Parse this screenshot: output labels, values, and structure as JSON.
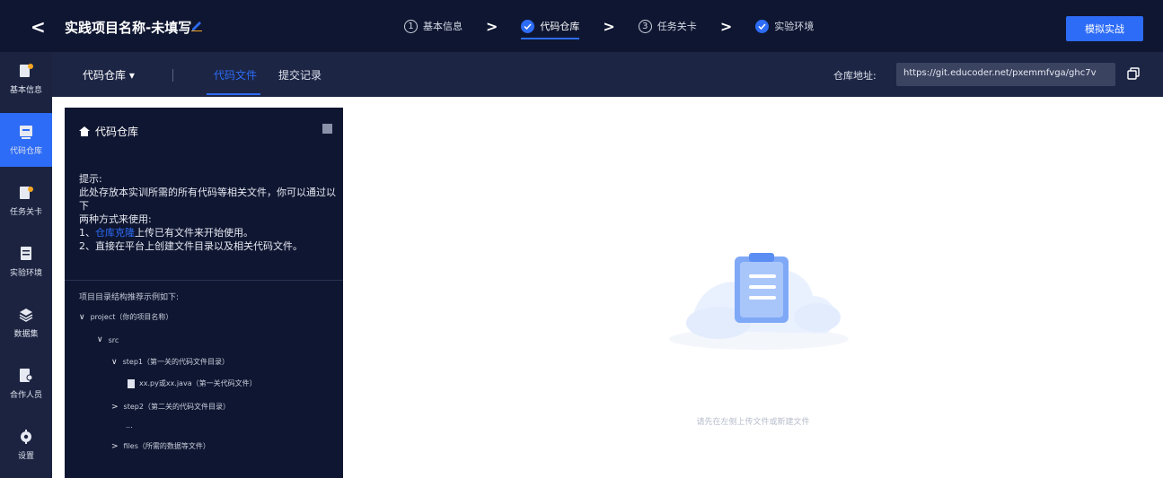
{
  "header": {
    "back_glyph": "<",
    "project_title": "实践项目名称-未填写",
    "steps": [
      {
        "num": "1",
        "label": "基本信息",
        "state": "todo"
      },
      {
        "num": "2",
        "label": "代码仓库",
        "state": "done"
      },
      {
        "num": "3",
        "label": "任务关卡",
        "state": "todo"
      },
      {
        "num": "4",
        "label": "实验环境",
        "state": "done"
      }
    ],
    "step_separator": ">",
    "publish_label": "模拟实战"
  },
  "sidebar": {
    "items": [
      {
        "label": "基本信息",
        "icon": "basic-info-icon"
      },
      {
        "label": "代码仓库",
        "icon": "code-repo-icon"
      },
      {
        "label": "任务关卡",
        "icon": "task-level-icon"
      },
      {
        "label": "实验环境",
        "icon": "lab-env-icon"
      },
      {
        "label": "数据集",
        "icon": "dataset-icon"
      },
      {
        "label": "合作人员",
        "icon": "collaborator-icon"
      },
      {
        "label": "设置",
        "icon": "settings-icon"
      }
    ]
  },
  "subbar": {
    "repo_select": "代码仓库 ▾",
    "tabs": [
      "代码文件",
      "提交记录"
    ],
    "address_label": "仓库地址:",
    "address_value": "https://git.educoder.net/pxemmfvga/ghc7v"
  },
  "panel": {
    "title": "代码仓库",
    "tips": {
      "line1": "提示:",
      "line2": "此处存放本实训所需的所有代码等相关文件，你可以通过以下",
      "line3": "两种方式来使用:",
      "line4_prefix": "1、",
      "line4_link": "仓库克隆",
      "line4_suffix": "上传已有文件来开始使用。",
      "line5": "2、直接在平台上创建文件目录以及相关代码文件。"
    },
    "tree_title": "项目目录结构推荐示例如下:",
    "tree": [
      {
        "label": "project（你的项目名称）",
        "kind": "folder"
      },
      {
        "label": "src",
        "kind": "folder"
      },
      {
        "label": "step1（第一关的代码文件目录）",
        "kind": "folder"
      },
      {
        "label": "xx.py或xx.java（第一关代码文件）",
        "kind": "file"
      },
      {
        "label": "step2（第二关的代码文件目录）",
        "kind": "folder-collapsed"
      },
      {
        "label": "...",
        "kind": "ellipsis"
      },
      {
        "label": "files（所需的数据等文件）",
        "kind": "folder-collapsed"
      }
    ]
  },
  "empty": {
    "text": "请先在左侧上传文件或新建文件"
  },
  "colors": {
    "accent": "#2d6cf6",
    "topbar": "#0f1631",
    "subbar": "#1c2544",
    "sidebar": "#1b2340"
  }
}
